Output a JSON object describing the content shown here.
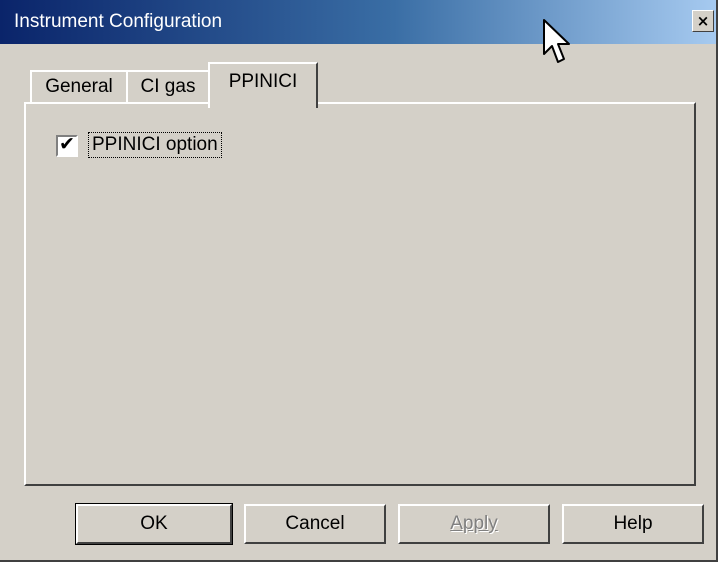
{
  "window": {
    "title": "Instrument Configuration",
    "close_glyph": "×",
    "cursor_icon": "arrow-cursor-icon"
  },
  "tabs": [
    {
      "label": "General",
      "selected": false
    },
    {
      "label": "CI gas",
      "selected": false
    },
    {
      "label": "PPINICI",
      "selected": true
    }
  ],
  "panel": {
    "checkbox": {
      "label": "PPINICI option",
      "checked": true,
      "check_glyph": "✔"
    }
  },
  "buttons": {
    "ok": "OK",
    "cancel": "Cancel",
    "apply": "Apply",
    "apply_enabled": false,
    "help": "Help"
  },
  "colors": {
    "title_gradient_start": "#0a246a",
    "title_gradient_end": "#a6caf0",
    "face": "#d4d0c8"
  }
}
